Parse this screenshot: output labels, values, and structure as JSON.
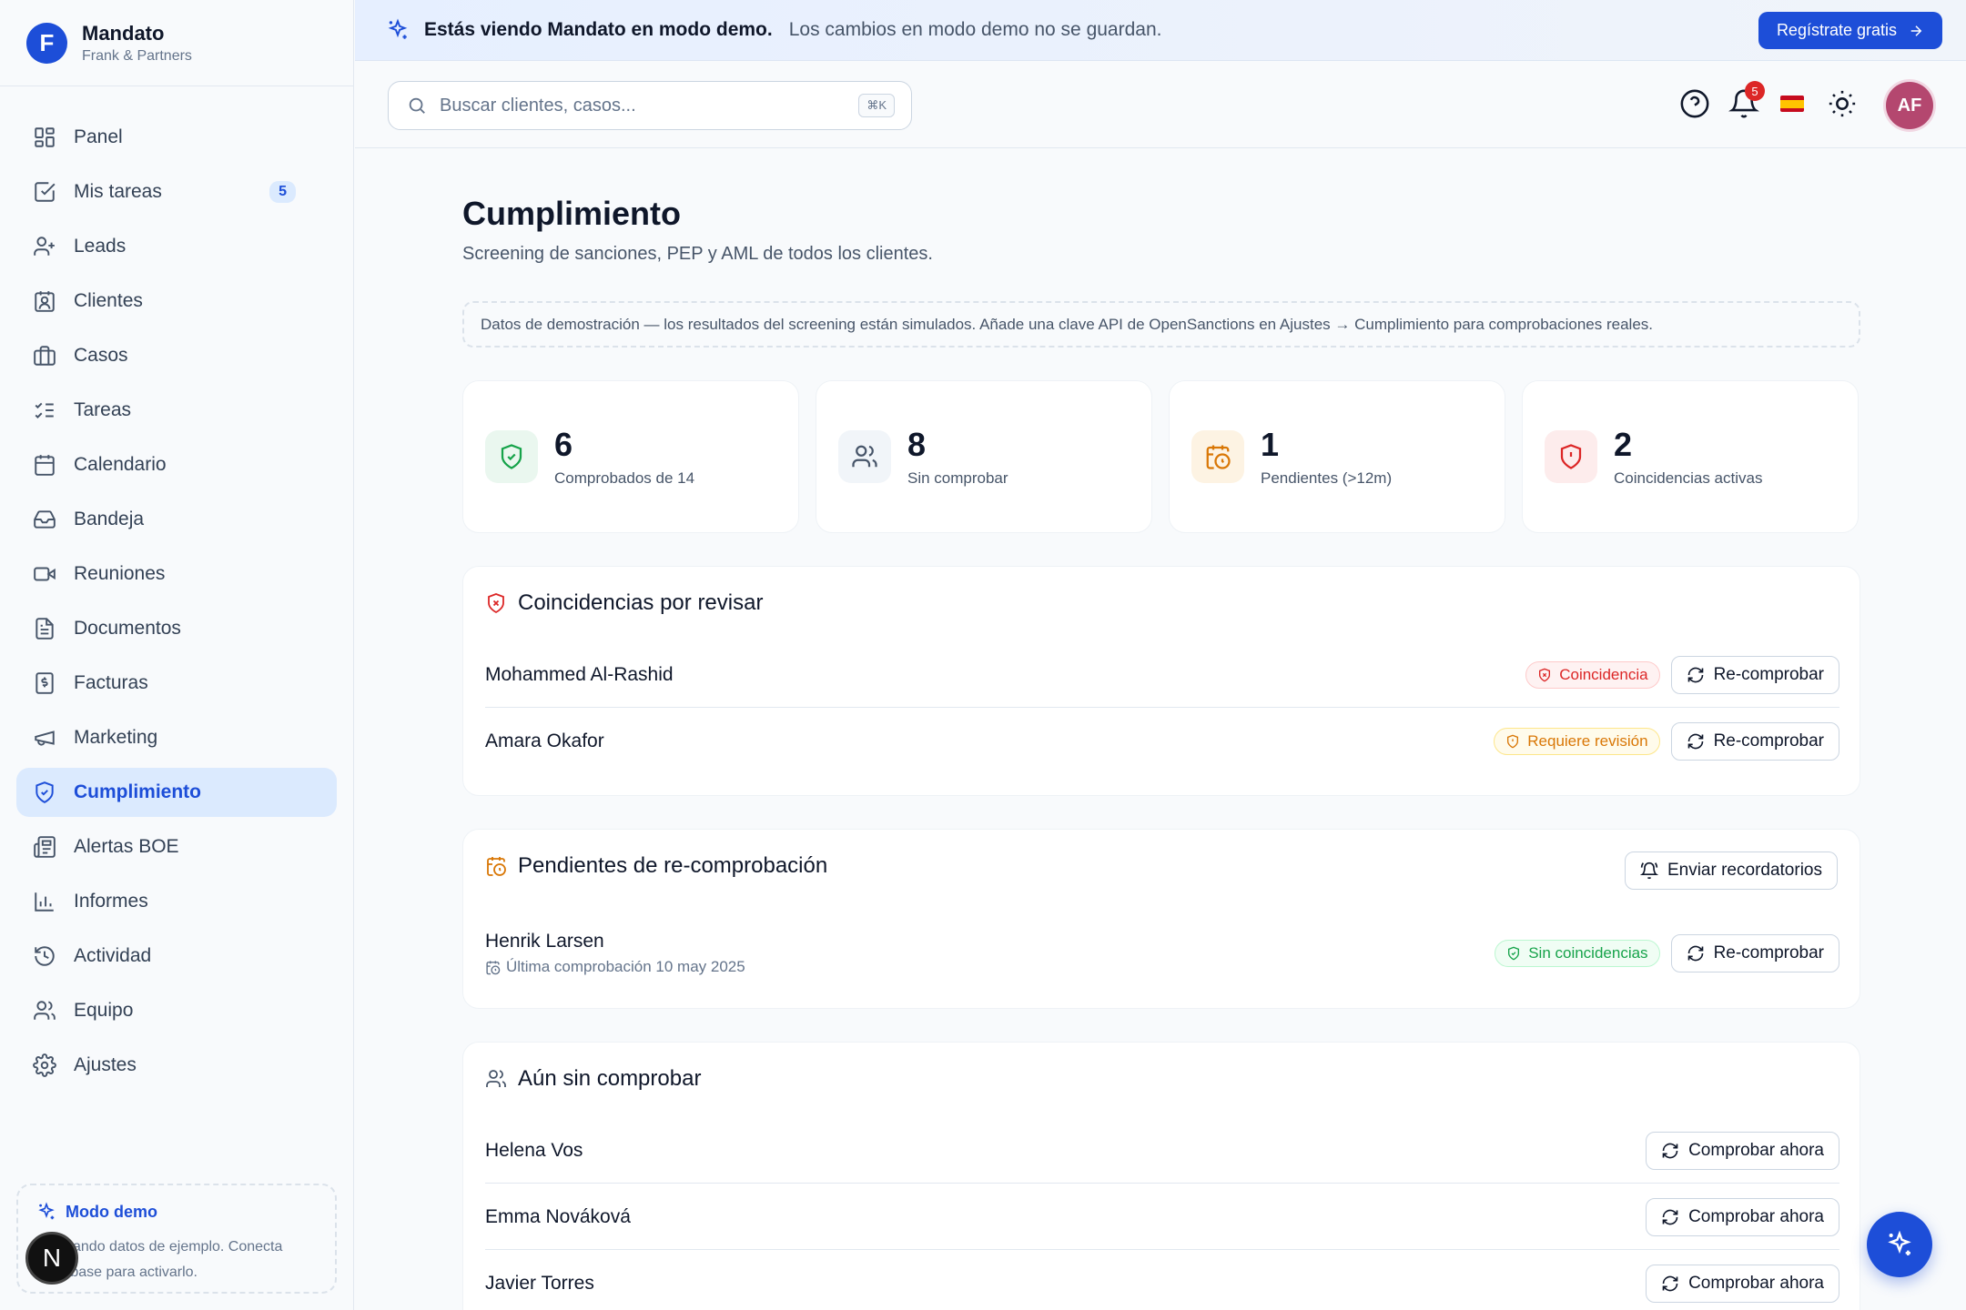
{
  "brand": {
    "initial": "F",
    "name": "Mandato",
    "org": "Frank & Partners"
  },
  "nav": [
    {
      "label": "Panel",
      "icon": "dashboard-icon"
    },
    {
      "label": "Mis tareas",
      "icon": "checkbox-icon",
      "badge": "5"
    },
    {
      "label": "Leads",
      "icon": "user-plus-icon"
    },
    {
      "label": "Clientes",
      "icon": "contact-icon"
    },
    {
      "label": "Casos",
      "icon": "briefcase-icon"
    },
    {
      "label": "Tareas",
      "icon": "list-checks-icon"
    },
    {
      "label": "Calendario",
      "icon": "calendar-icon"
    },
    {
      "label": "Bandeja",
      "icon": "inbox-icon"
    },
    {
      "label": "Reuniones",
      "icon": "video-icon"
    },
    {
      "label": "Documentos",
      "icon": "file-icon"
    },
    {
      "label": "Facturas",
      "icon": "receipt-icon"
    },
    {
      "label": "Marketing",
      "icon": "megaphone-icon"
    },
    {
      "label": "Cumplimiento",
      "icon": "shield-check-icon",
      "active": true
    },
    {
      "label": "Alertas BOE",
      "icon": "newspaper-icon"
    },
    {
      "label": "Informes",
      "icon": "bar-chart-icon"
    },
    {
      "label": "Actividad",
      "icon": "history-icon"
    },
    {
      "label": "Equipo",
      "icon": "users-icon"
    },
    {
      "label": "Ajustes",
      "icon": "gear-icon"
    }
  ],
  "demo_box": {
    "title": "Modo demo",
    "text": "Mostrando datos de ejemplo. Conecta Supabase para activarlo."
  },
  "dev_badge": "N",
  "banner": {
    "title": "Estás viendo Mandato en modo demo.",
    "subtitle": "Los cambios en modo demo no se guardan.",
    "cta": "Regístrate gratis"
  },
  "toolbar": {
    "search_placeholder": "Buscar clientes, casos...",
    "search_shortcut": "⌘K",
    "notifications_count": "5",
    "avatar_initials": "AF"
  },
  "page": {
    "title": "Cumplimiento",
    "subtitle": "Screening de sanciones, PEP y AML de todos los clientes.",
    "notice": "Datos de demostración — los resultados del screening están simulados. Añade una clave API de OpenSanctions en Ajustes → Cumplimiento para comprobaciones reales."
  },
  "stats": [
    {
      "value": "6",
      "label": "Comprobados de 14",
      "icon": "shield-check-icon",
      "color": "#16a34a",
      "bg": "#eaf7ef"
    },
    {
      "value": "8",
      "label": "Sin comprobar",
      "icon": "users-icon",
      "color": "#475569",
      "bg": "#f1f5f9"
    },
    {
      "value": "1",
      "label": "Pendientes (>12m)",
      "icon": "calendar-clock-icon",
      "color": "#d97706",
      "bg": "#fdf3e3"
    },
    {
      "value": "2",
      "label": "Coincidencias activas",
      "icon": "shield-alert-icon",
      "color": "#dc2626",
      "bg": "#fdecec"
    }
  ],
  "matches": {
    "title": "Coincidencias por revisar",
    "rows": [
      {
        "name": "Mohammed Al-Rashid",
        "status": "Coincidencia",
        "action": "Re-comprobar"
      },
      {
        "name": "Amara Okafor",
        "status": "Requiere revisión",
        "action": "Re-comprobar"
      }
    ]
  },
  "pending": {
    "title": "Pendientes de re-comprobación",
    "action": "Enviar recordatorios",
    "rows": [
      {
        "name": "Henrik Larsen",
        "meta": "Última comprobación 10 may 2025",
        "status": "Sin coincidencias",
        "action": "Re-comprobar"
      }
    ]
  },
  "unchecked": {
    "title": "Aún sin comprobar",
    "rows": [
      {
        "name": "Helena Vos",
        "action": "Comprobar ahora"
      },
      {
        "name": "Emma Nováková",
        "action": "Comprobar ahora"
      },
      {
        "name": "Javier Torres",
        "action": "Comprobar ahora"
      }
    ]
  }
}
